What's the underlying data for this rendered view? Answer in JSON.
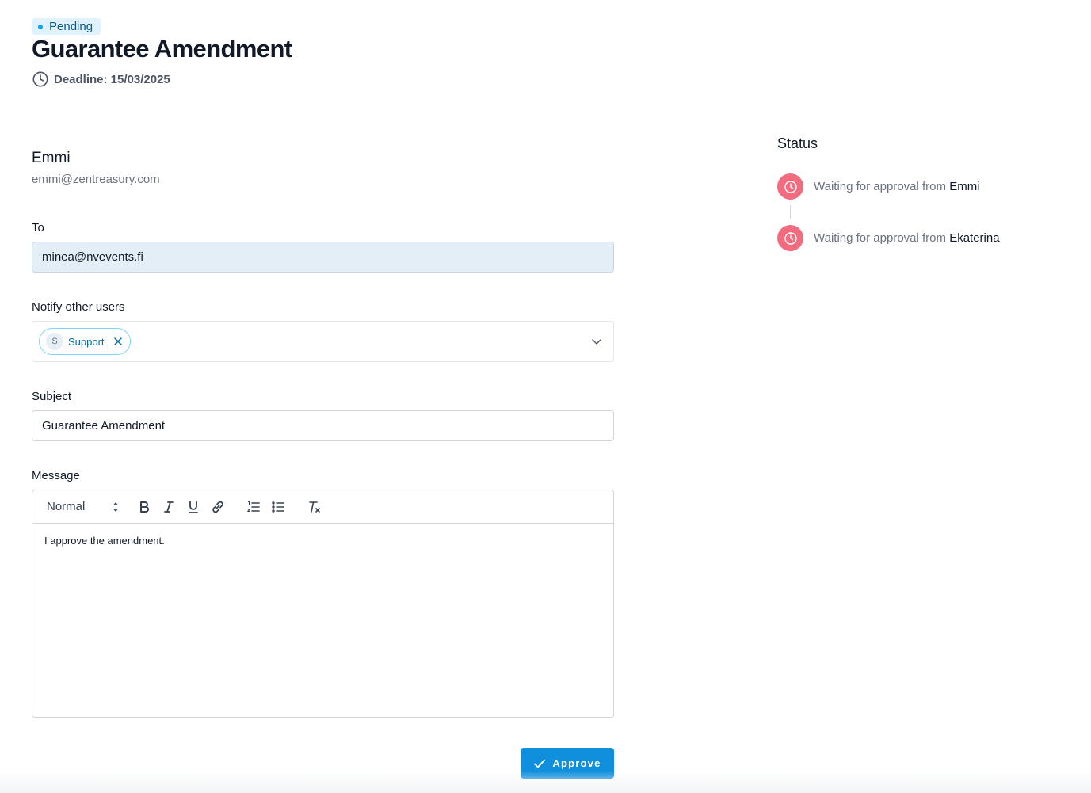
{
  "header": {
    "status_badge": "Pending",
    "title": "Guarantee Amendment",
    "deadline": "Deadline: 15/03/2025"
  },
  "sender": {
    "name": "Emmi",
    "email": "emmi@zentreasury.com"
  },
  "form": {
    "to_label": "To",
    "to_value": "minea@nvevents.fi",
    "notify_label": "Notify other users",
    "notify_chips": [
      {
        "initial": "S",
        "label": "Support"
      }
    ],
    "subject_label": "Subject",
    "subject_value": "Guarantee Amendment",
    "message_label": "Message",
    "format_select": "Normal",
    "message_body": "I approve the amendment."
  },
  "toolbar_icons": [
    "bold-icon",
    "italic-icon",
    "underline-icon",
    "link-icon",
    "ordered-list-icon",
    "bullet-list-icon",
    "clear-format-icon"
  ],
  "actions": {
    "approve_label": "Approve"
  },
  "status": {
    "heading": "Status",
    "items": [
      {
        "prefix": "Waiting for approval from ",
        "name": "Emmi"
      },
      {
        "prefix": "Waiting for approval from ",
        "name": "Ekaterina"
      }
    ]
  },
  "colors": {
    "accent": "#0f8fdc",
    "pending_badge_bg": "#e0f2fe",
    "status_waiting": "#f26b7e"
  }
}
